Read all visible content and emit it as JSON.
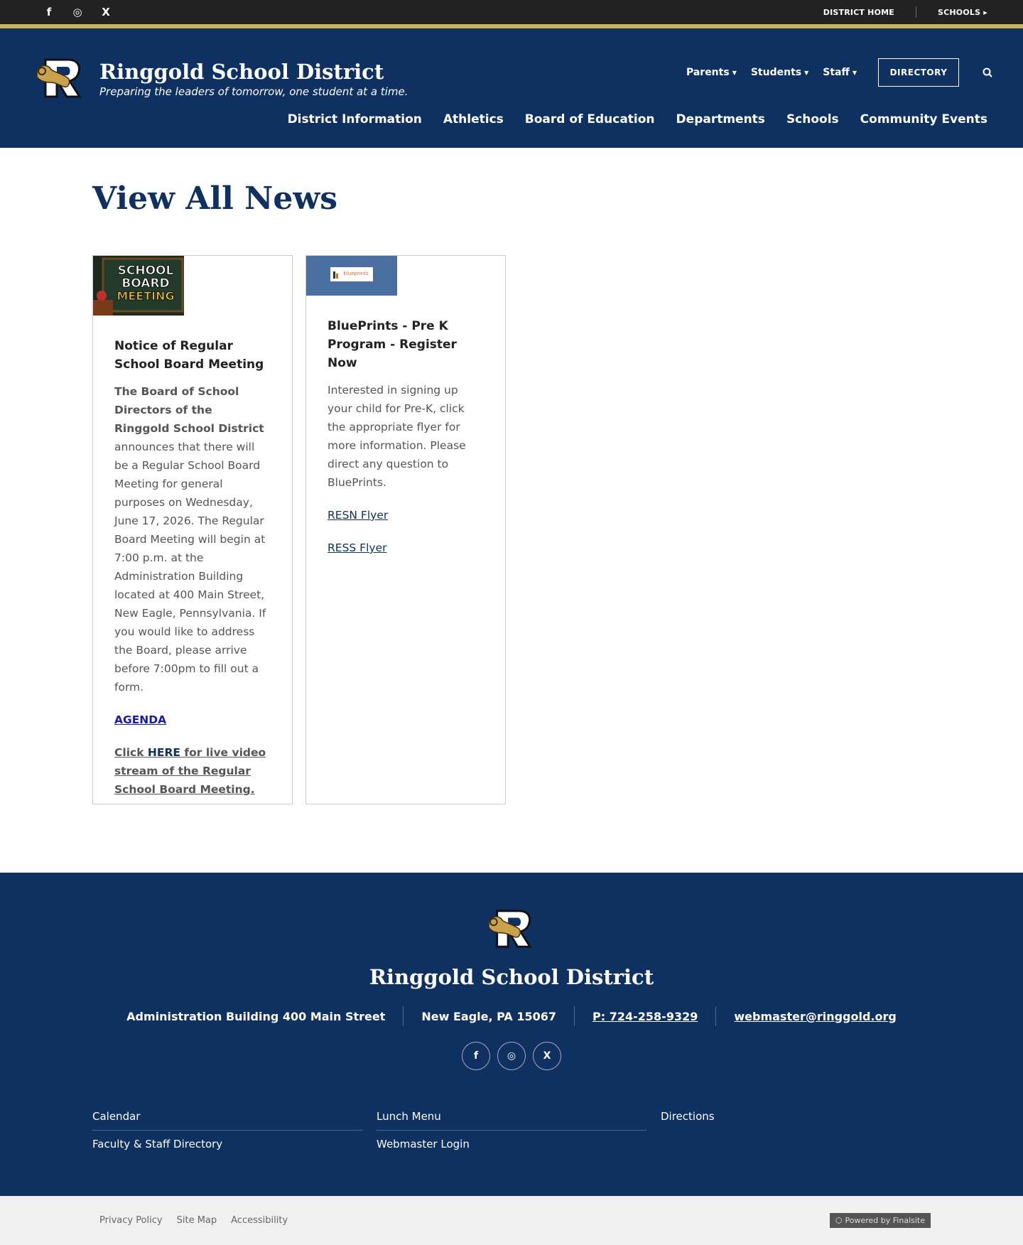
{
  "topbar": {
    "social": [
      {
        "icon": "facebook-icon",
        "glyph": "f"
      },
      {
        "icon": "instagram-icon",
        "glyph": "◎"
      },
      {
        "icon": "x-icon",
        "glyph": "X"
      }
    ],
    "district_home": "DISTRICT HOME",
    "schools": "SCHOOLS ▸"
  },
  "header": {
    "site_name": "Ringgold School District",
    "tagline": "Preparing the leaders of tomorrow, one student at a time.",
    "util_nav": [
      "Parents",
      "Students",
      "Staff"
    ],
    "directory": "DIRECTORY",
    "main_nav": [
      "District Information",
      "Athletics",
      "Board of Education",
      "Departments",
      "Schools",
      "Community Events"
    ]
  },
  "main": {
    "title": "View All News",
    "card1": {
      "image_text": [
        "SCHOOL",
        "BOARD",
        "MEETING"
      ],
      "title": "Notice of Regular School Board Meeting",
      "body_bold": "The Board of School Directors of the Ringgold School District",
      "body": " announces that there will be a Regular School Board Meeting for general purposes on Wednesday, June 17, 2026. The Regular Board Meeting will begin at 7:00 p.m. at the Administration Building located at 400 Main Street, New Eagle, Pennsylvania. If you would like to address the Board, please arrive before 7:00pm to fill out a form.",
      "agenda": "AGENDA",
      "click": "Click ",
      "here": "HERE",
      "stream": " for live video stream of the Regular School Board Meeting."
    },
    "card2": {
      "image_text": "blueprints",
      "title": "BluePrints - Pre K Program - Register Now",
      "body": "Interested in signing up your child for Pre-K, click the appropriate flyer for more information.  Please direct any question to BluePrints.",
      "link1": "RESN Flyer",
      "link2": "RESS Flyer"
    }
  },
  "footer": {
    "name": "Ringgold School District",
    "address": "Administration Building 400 Main Street",
    "city": "New Eagle, PA  15067",
    "phone": "P: 724-258-9329",
    "email": "webmaster@ringgold.org",
    "social": [
      {
        "icon": "facebook-icon",
        "glyph": "f"
      },
      {
        "icon": "instagram-icon",
        "glyph": "◎"
      },
      {
        "icon": "x-icon",
        "glyph": "X"
      }
    ],
    "links": [
      "Calendar",
      "Lunch Menu",
      "Directions",
      "Faculty & Staff Directory",
      "Webmaster Login"
    ]
  },
  "bottombar": {
    "links": [
      "Privacy Policy",
      "Site Map",
      "Accessibility"
    ],
    "powered": "Powered by Finalsite"
  },
  "colors": {
    "navy": "#0e3161",
    "gold": "#c9b458",
    "dark": "#222222"
  }
}
